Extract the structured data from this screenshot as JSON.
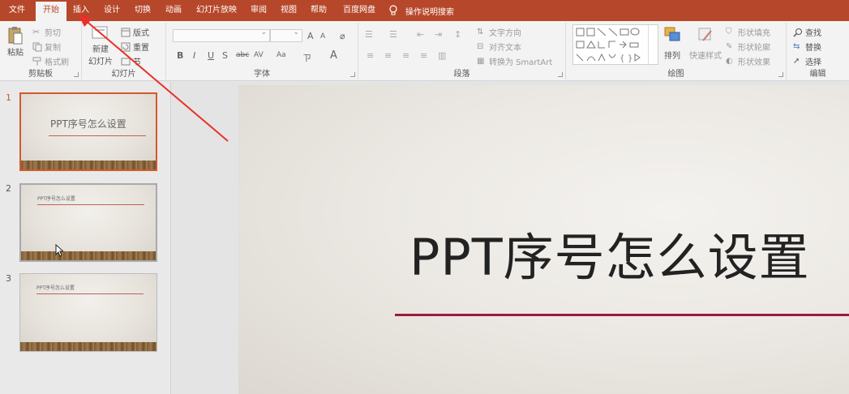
{
  "tabs": {
    "file": "文件",
    "home": "开始",
    "insert": "插入",
    "design": "设计",
    "transitions": "切换",
    "animations": "动画",
    "slideshow": "幻灯片放映",
    "review": "审阅",
    "view": "视图",
    "help": "帮助",
    "baidu": "百度网盘",
    "tell_me": "操作说明搜索"
  },
  "clipboard": {
    "paste": "粘贴",
    "cut": "剪切",
    "copy": "复制",
    "format_painter": "格式刷",
    "label": "剪贴板"
  },
  "slides_group": {
    "new_slide_line1": "新建",
    "new_slide_line2": "幻灯片",
    "layout": "版式",
    "reset": "重置",
    "section": "节",
    "label": "幻灯片"
  },
  "font_group": {
    "bold": "B",
    "italic": "I",
    "underline": "U",
    "strike": "S",
    "abc": "abc",
    "spacing": "AV",
    "case": "Aa",
    "font_color": "A",
    "grow": "A",
    "shrink": "A",
    "label": "字体"
  },
  "paragraph_group": {
    "text_direction": "文字方向",
    "align_text": "对齐文本",
    "smartart": "转换为 SmartArt",
    "label": "段落"
  },
  "drawing_group": {
    "arrange": "排列",
    "quick_styles": "快速样式",
    "shape_fill": "形状填充",
    "shape_outline": "形状轮廓",
    "shape_effects": "形状效果",
    "label": "绘图"
  },
  "editing_group": {
    "find": "查找",
    "replace": "替换",
    "select": "选择",
    "label": "编辑"
  },
  "thumbnails": [
    {
      "number": "1",
      "title": "PPT序号怎么设置"
    },
    {
      "number": "2",
      "title": "PPT序号怎么设置"
    },
    {
      "number": "3",
      "title": "PPT序号怎么设置"
    }
  ],
  "slide": {
    "title": "PPT序号怎么设置"
  },
  "colors": {
    "accent": "#b7472a",
    "title_underline": "#9b1b3e",
    "annotation_arrow": "#e8312a"
  }
}
